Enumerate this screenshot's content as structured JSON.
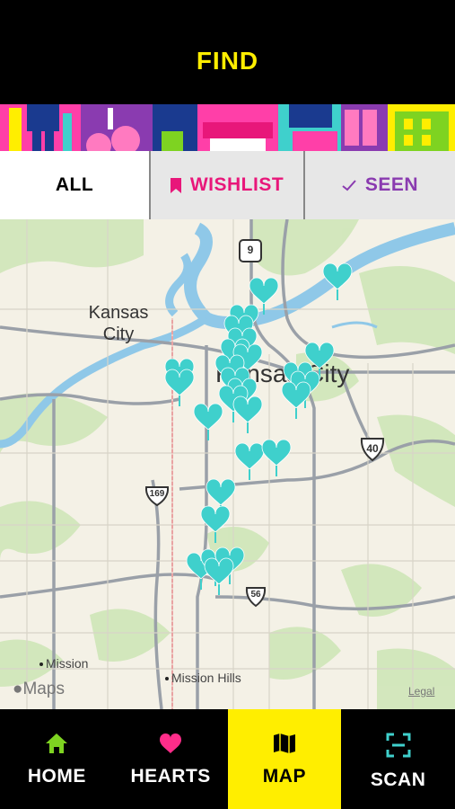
{
  "header": {
    "title": "FIND"
  },
  "filters": [
    {
      "label": "ALL",
      "icon": "none",
      "active": true
    },
    {
      "label": "WISHLIST",
      "icon": "bookmark-icon",
      "color": "#e8177a"
    },
    {
      "label": "SEEN",
      "icon": "checkmark-icon",
      "color": "#8a3bb0"
    }
  ],
  "map": {
    "city_labels": [
      "Kansas\nCity",
      "Kansas City"
    ],
    "places": [
      "Mission",
      "Mission Hills"
    ],
    "shields": [
      "9",
      "40",
      "169",
      "56"
    ],
    "attribution": "Maps",
    "legal": "Legal",
    "marker_color": "#3fd0cc"
  },
  "tabs": [
    {
      "label": "HOME",
      "icon": "home-icon",
      "color": "#7ed321"
    },
    {
      "label": "HEARTS",
      "icon": "heart-icon",
      "color": "#ff2d8a"
    },
    {
      "label": "MAP",
      "icon": "map-icon",
      "active": true
    },
    {
      "label": "SCAN",
      "icon": "scan-icon",
      "color": "#3fd0cc"
    }
  ]
}
